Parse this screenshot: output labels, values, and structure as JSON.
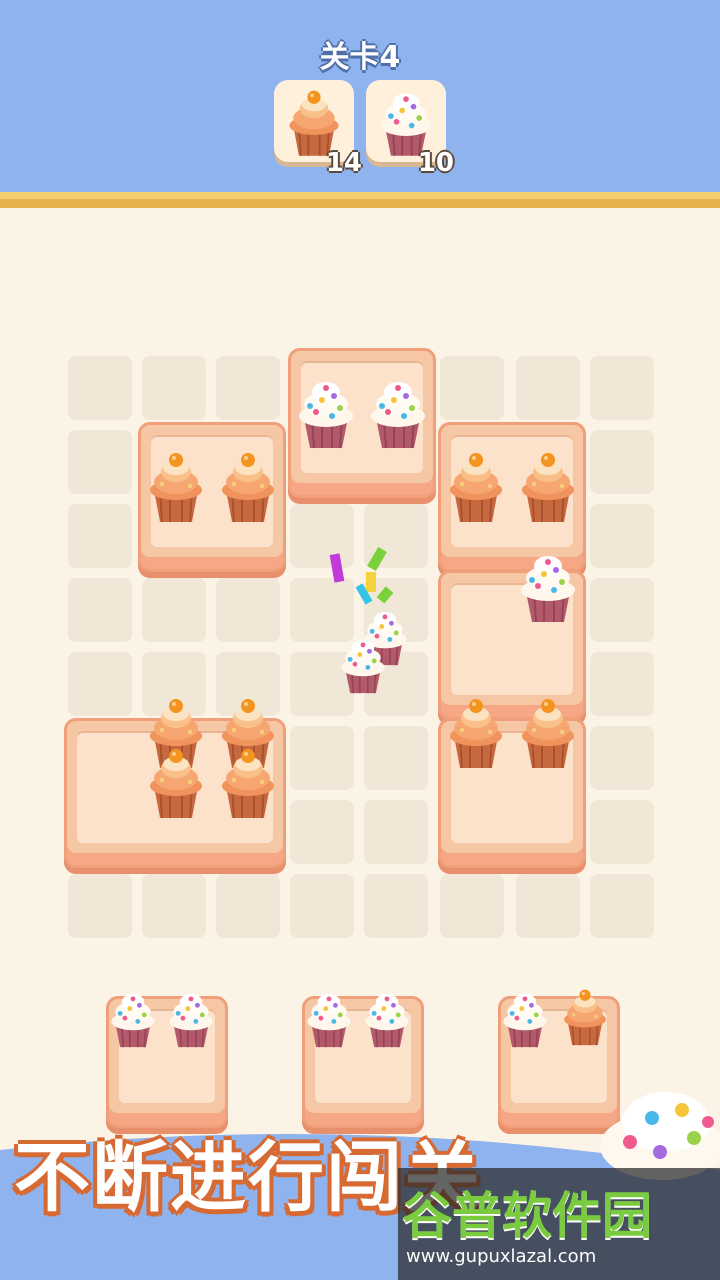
{
  "level": {
    "title": "关卡4"
  },
  "targets": [
    {
      "cupcake": "orange-cupcake-icon",
      "count": "14"
    },
    {
      "cupcake": "sprinkle-cupcake-icon",
      "count": "10"
    }
  ],
  "banner": {
    "text": "不断进行闯关"
  },
  "watermark": {
    "brand": "谷普软件园",
    "url": "www.gupuxlazal.com"
  },
  "colors": {
    "header": "#8fb3ee",
    "background": "#fbf3e6",
    "tray": "#f5c7a4",
    "tray_border": "#f09f7a",
    "grid_cell": "#f1e7d6",
    "banner_outline": "#d76a32"
  }
}
